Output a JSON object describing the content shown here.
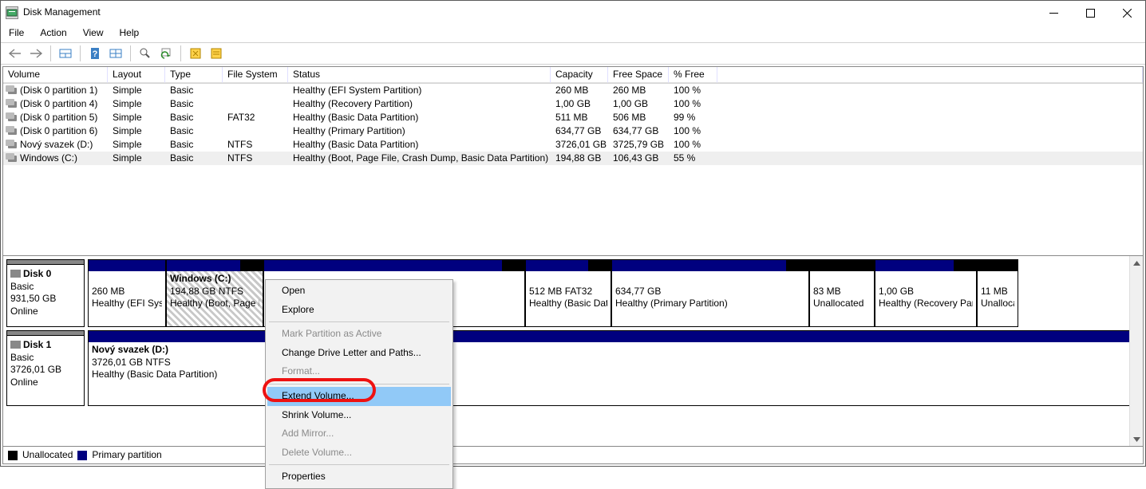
{
  "window": {
    "title": "Disk Management"
  },
  "menu": {
    "file": "File",
    "action": "Action",
    "view": "View",
    "help": "Help"
  },
  "columns": {
    "volume": "Volume",
    "layout": "Layout",
    "type": "Type",
    "fs": "File System",
    "status": "Status",
    "capacity": "Capacity",
    "free": "Free Space",
    "pfree": "% Free"
  },
  "volumes": [
    {
      "name": "(Disk 0 partition 1)",
      "layout": "Simple",
      "type": "Basic",
      "fs": "",
      "status": "Healthy (EFI System Partition)",
      "capacity": "260 MB",
      "free": "260 MB",
      "pfree": "100 %"
    },
    {
      "name": "(Disk 0 partition 4)",
      "layout": "Simple",
      "type": "Basic",
      "fs": "",
      "status": "Healthy (Recovery Partition)",
      "capacity": "1,00 GB",
      "free": "1,00 GB",
      "pfree": "100 %"
    },
    {
      "name": "(Disk 0 partition 5)",
      "layout": "Simple",
      "type": "Basic",
      "fs": "FAT32",
      "status": "Healthy (Basic Data Partition)",
      "capacity": "511 MB",
      "free": "506 MB",
      "pfree": "99 %"
    },
    {
      "name": "(Disk 0 partition 6)",
      "layout": "Simple",
      "type": "Basic",
      "fs": "",
      "status": "Healthy (Primary Partition)",
      "capacity": "634,77 GB",
      "free": "634,77 GB",
      "pfree": "100 %"
    },
    {
      "name": "Nový svazek (D:)",
      "layout": "Simple",
      "type": "Basic",
      "fs": "NTFS",
      "status": "Healthy (Basic Data Partition)",
      "capacity": "3726,01 GB",
      "free": "3725,79 GB",
      "pfree": "100 %"
    },
    {
      "name": "Windows (C:)",
      "layout": "Simple",
      "type": "Basic",
      "fs": "NTFS",
      "status": "Healthy (Boot, Page File, Crash Dump, Basic Data Partition)",
      "capacity": "194,88 GB",
      "free": "106,43 GB",
      "pfree": "55 %"
    }
  ],
  "disk0": {
    "name": "Disk 0",
    "type": "Basic",
    "size": "931,50 GB",
    "status": "Online",
    "parts": [
      {
        "line1": "",
        "line2": "260 MB",
        "line3": "Healthy (EFI System Partition)"
      },
      {
        "line1": "Windows  (C:)",
        "line2": "194,88 GB NTFS",
        "line3": "Healthy (Boot, Page File, Crash Dump, Basic Data Partition)"
      },
      {
        "line1": "",
        "line2": "512 MB FAT32",
        "line3": "Healthy (Basic Data Partition)"
      },
      {
        "line1": "",
        "line2": "634,77 GB",
        "line3": "Healthy (Primary Partition)"
      },
      {
        "line1": "",
        "line2": "83 MB",
        "line3": "Unallocated"
      },
      {
        "line1": "",
        "line2": "1,00 GB",
        "line3": "Healthy (Recovery Partition)"
      },
      {
        "line1": "",
        "line2": "11 MB",
        "line3": "Unallocated"
      }
    ]
  },
  "disk1": {
    "name": "Disk 1",
    "type": "Basic",
    "size": "3726,01 GB",
    "status": "Online",
    "parts": [
      {
        "line1": "Nový svazek  (D:)",
        "line2": "3726,01 GB NTFS",
        "line3": "Healthy (Basic Data Partition)"
      }
    ]
  },
  "legend": {
    "unallocated": "Unallocated",
    "primary": "Primary partition"
  },
  "context": {
    "open": "Open",
    "explore": "Explore",
    "mark": "Mark Partition as Active",
    "change": "Change Drive Letter and Paths...",
    "format": "Format...",
    "extend": "Extend Volume...",
    "shrink": "Shrink Volume...",
    "addmirror": "Add Mirror...",
    "delete": "Delete Volume...",
    "props": "Properties"
  }
}
